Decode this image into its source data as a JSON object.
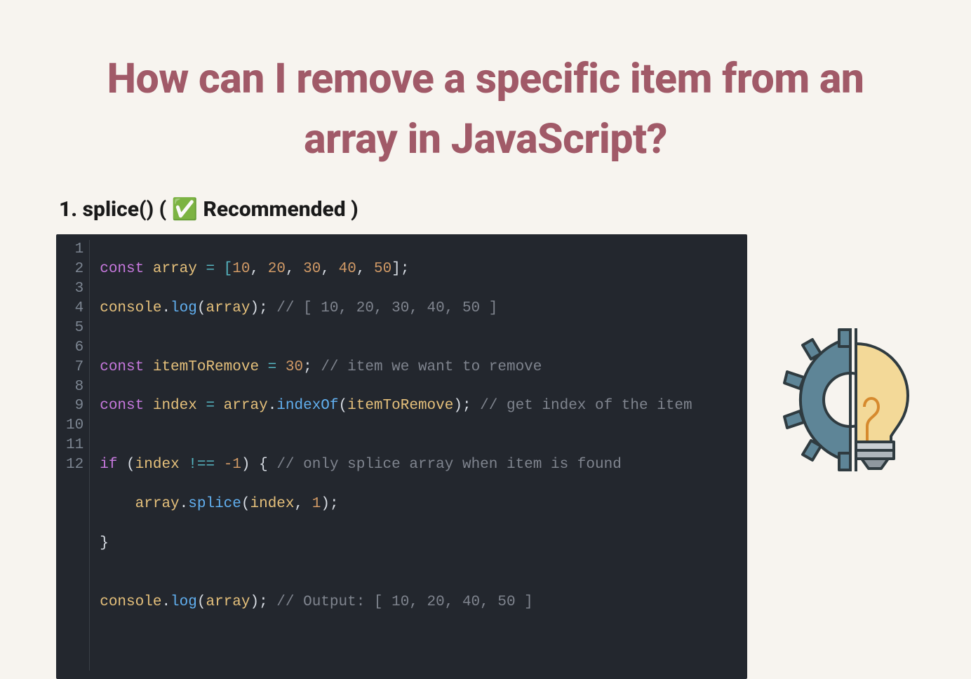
{
  "title": "How can I remove a specific item from an array in JavaScript?",
  "subhead": {
    "prefix": "1. splice() ( ",
    "check": "✅",
    "suffix": " Recommended )"
  },
  "code": {
    "line_numbers": [
      "1",
      "2",
      "3",
      "4",
      "5",
      "6",
      "7",
      "8",
      "9",
      "10",
      "11",
      "12"
    ],
    "lines": {
      "l1": {
        "a": "const",
        "b": "array",
        "c": " = [",
        "d1": "10",
        "d2": "20",
        "d3": "30",
        "d4": "40",
        "d5": "50",
        "e": "];",
        "sep": ", "
      },
      "l2": {
        "a": "console",
        "b": ".",
        "c": "log",
        "d": "(",
        "e": "array",
        "f": "); ",
        "g": "// [ 10, 20, 30, 40, 50 ]"
      },
      "l3": "",
      "l4": {
        "a": "const",
        "b": "itemToRemove",
        "c": " = ",
        "d": "30",
        "e": "; ",
        "f": "// item we want to remove"
      },
      "l5": {
        "a": "const",
        "b": "index",
        "c": " = ",
        "d": "array",
        "e": ".",
        "f": "indexOf",
        "g": "(",
        "h": "itemToRemove",
        "i": "); ",
        "j": "// get index of the item"
      },
      "l6": "",
      "l7": {
        "a": "if",
        "b": " (",
        "c": "index",
        "d": " !== ",
        "e": "-1",
        "f": ") { ",
        "g": "// only splice array when item is found"
      },
      "l8": {
        "indent": "    ",
        "a": "array",
        "b": ".",
        "c": "splice",
        "d": "(",
        "e": "index",
        "f": ", ",
        "g": "1",
        "h": ");"
      },
      "l9": "}",
      "l10": "",
      "l11": {
        "a": "console",
        "b": ".",
        "c": "log",
        "d": "(",
        "e": "array",
        "f": "); ",
        "g": "// Output: [ 10, 20, 40, 50 ]"
      },
      "l12": ""
    }
  },
  "colors": {
    "bg": "#f7f4ef",
    "title": "#a15a68",
    "code_bg": "#23272e",
    "keyword": "#c678dd",
    "variable": "#e5c07b",
    "operator": "#56b6c2",
    "number": "#d19a66",
    "function": "#61afef",
    "comment": "#7f848e",
    "gear": "#5e8597",
    "bulb": "#f3d998"
  }
}
